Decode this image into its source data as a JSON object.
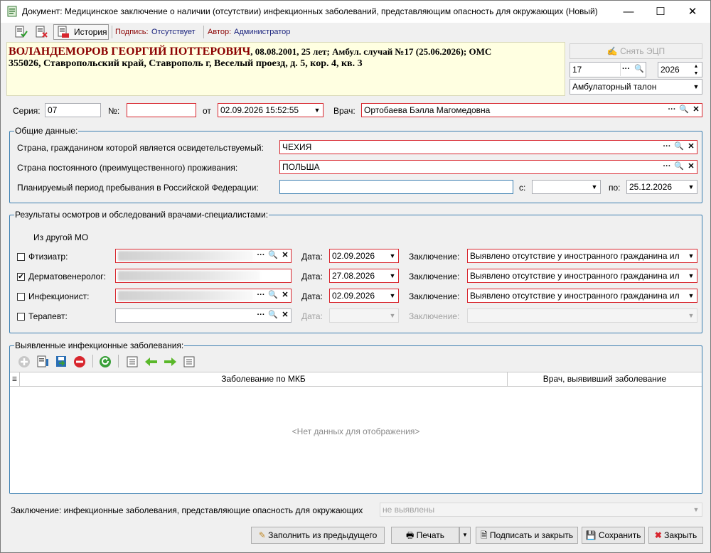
{
  "window": {
    "title": "Документ: Медицинское заключение о наличии (отсутствии) инфекционных заболеваний, представляющим опасность для окружающих (Новый)",
    "minimize": "—",
    "maximize": "☐",
    "close": "✕"
  },
  "toolbar": {
    "history_label": "История",
    "signature_label": "Подпись:",
    "signature_value": "Отсутствует",
    "author_label": "Автор:",
    "author_value": "Администратор"
  },
  "patient": {
    "name": "ВОЛАНДЕМОРОВ ГЕОРГИЙ ПОТТЕРОВИЧ",
    "details": ", 08.08.2001, 25 лет; Амбул. случай №17 (25.06.2026); ОМС",
    "address": "355026, Ставропольский край, Ставрополь г, Веселый проезд, д. 5, кор. 4, кв. 3"
  },
  "right_panel": {
    "remove_signature": "Снять ЭЦП",
    "case_number": "17",
    "year": "2026",
    "doc_type": "Амбулаторный талон"
  },
  "doc": {
    "series_label": "Серия:",
    "series_value": "07",
    "number_label": "№:",
    "number_value": "",
    "from_label": "от",
    "date_value": "02.09.2026 15:52:55",
    "doctor_label": "Врач:",
    "doctor_value": "Ортобаева Бэлла Магомедовна"
  },
  "general": {
    "title": "Общие данные:",
    "citizenship_label": "Страна, гражданином которой является освидетельствуемый:",
    "citizenship_value": "ЧЕХИЯ",
    "residence_label": "Страна постоянного (преимущественного) проживания:",
    "residence_value": "ПОЛЬША",
    "period_label": "Планируемый период пребывания в Российской Федерации:",
    "period_value": "",
    "from_label": "с:",
    "from_value": "",
    "to_label": "по:",
    "to_value": "25.12.2026"
  },
  "results": {
    "title": "Результаты осмотров и обследований врачами-специалистами:",
    "other_mo": "Из другой МО",
    "date_label": "Дата:",
    "conclusion_label": "Заключение:",
    "rows": [
      {
        "name": "Фтизиатр:",
        "checked": "",
        "date": "02.09.2026",
        "conclusion": "Выявлено отсутствие у иностранного гражданина ил"
      },
      {
        "name": "Дерматовенеролог:",
        "checked": "✔",
        "date": "27.08.2026",
        "conclusion": "Выявлено отсутствие у иностранного гражданина ил"
      },
      {
        "name": "Инфекционист:",
        "checked": "",
        "date": "02.09.2026",
        "conclusion": "Выявлено отсутствие у иностранного гражданина ил"
      },
      {
        "name": "Терапевт:",
        "checked": "",
        "date": "",
        "conclusion": ""
      }
    ]
  },
  "diseases": {
    "title": "Выявленные инфекционные заболевания:",
    "col_mkb": "Заболевание по МКБ",
    "col_doctor": "Врач, выявивший заболевание",
    "empty": "<Нет данных для отображения>"
  },
  "footer": {
    "conclusion_label": "Заключение: инфекционные заболевания, представляющие опасность для окружающих",
    "conclusion_value": "не выявлены",
    "fill_prev": "Заполнить из предыдущего",
    "print": "Печать",
    "sign_close": "Подписать и закрыть",
    "save": "Сохранить",
    "close": "Закрыть"
  },
  "colors": {
    "required_border": "#d8262e",
    "focus_border": "#3c7fb1",
    "patient_name": "#8b0000",
    "header_bg": "#ffffe1"
  }
}
